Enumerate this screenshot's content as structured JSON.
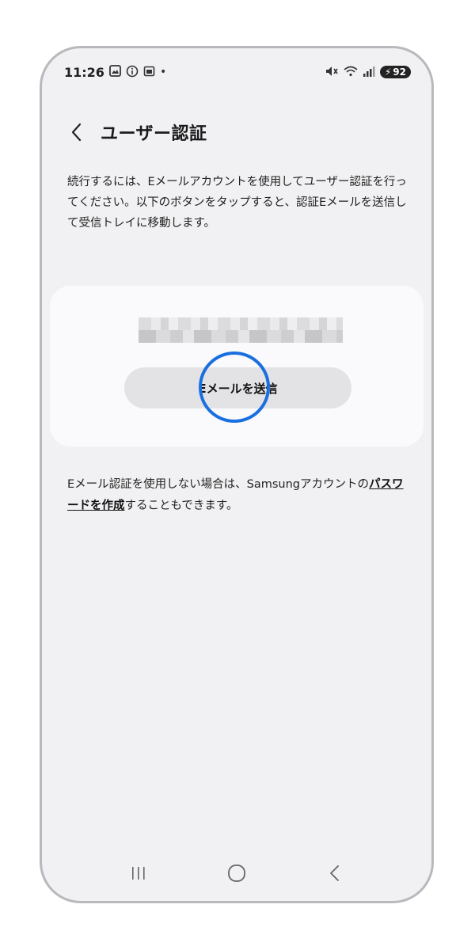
{
  "status_bar": {
    "time": "11:26",
    "left_icons": [
      "gallery-icon",
      "info-icon",
      "calendar-icon",
      "dot-icon"
    ],
    "right_icons": [
      "mute-icon",
      "wifi-icon",
      "signal-icon"
    ],
    "battery_level": "92"
  },
  "header": {
    "title": "ユーザー認証",
    "back_icon": "chevron-left-icon"
  },
  "description": "続行するには、Eメールアカウントを使用してユーザー認証を行ってください。以下のボタンをタップすると、認証Eメールを送信して受信トレイに移動します。",
  "card": {
    "email_redacted": true,
    "send_button_label": "Eメールを送信"
  },
  "footer_note": {
    "text_before": "Eメール認証を使用しない場合は、Samsungアカウントの",
    "link_text": "パスワードを作成",
    "text_after": "することもできます。"
  },
  "nav_bar": {
    "icons": [
      "recent-apps-icon",
      "home-icon",
      "back-icon"
    ]
  },
  "colors": {
    "background": "#f1f1f3",
    "card": "#fafafc",
    "button": "#e3e3e5",
    "focus_ring": "#1a6fe0"
  }
}
